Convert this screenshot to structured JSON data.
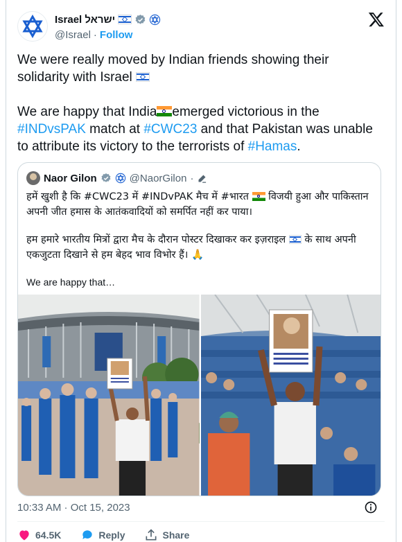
{
  "tweet": {
    "display_name": "Israel ישראל",
    "handle": "@Israel",
    "separator": "·",
    "follow_label": "Follow",
    "paragraph1": "We were really moved by Indian friends showing their solidarity with Israel",
    "p2_part1": "We are happy that India",
    "p2_part2": "emerged victorious in the",
    "hashtag1": "#INDvsPAK",
    "p2_part3": " match at ",
    "hashtag2": "#CWC23",
    "p2_part4": " and that Pakistan was unable to attribute its victory to the terrorists of ",
    "hashtag3": "#Hamas",
    "p2_part5": ".",
    "timestamp": "10:33 AM · Oct 15, 2023"
  },
  "quote": {
    "name": "Naor Gilon",
    "handle": "@NaorGilon",
    "separator": "·",
    "hindi1_a": "हमें खुशी है कि #CWC23 में #INDvPAK मैच में #भारत",
    "hindi1_b": "विजयी हुआ और पाकिस्तान अपनी जीत हमास के आतंकवादियों को समर्पित नहीं कर पाया।",
    "hindi2_a": "हम हमारे भारतीय मित्रों द्वारा मैच के दौरान पोस्टर दिखाकर कर इज़राइल",
    "hindi2_b": "के साथ अपनी एकजुटता दिखाने से हम बेहद भाव विभोर हैं।",
    "hindi2_emoji": "🙏",
    "more_text": "We are happy that…"
  },
  "actions": {
    "likes": "64.5K",
    "reply_label": "Reply",
    "share_label": "Share"
  },
  "colors": {
    "link_blue": "#1d9bf0",
    "like_red": "#f91880",
    "muted": "#536471",
    "text": "#0f1419"
  },
  "icons": [
    "israel-star-of-david-avatar",
    "israel-flag-icon",
    "verified-badge-icon",
    "gov-affiliation-icon",
    "x-logo-icon",
    "india-flag-icon",
    "edit-pencil-icon",
    "info-icon",
    "heart-icon",
    "reply-icon",
    "share-icon"
  ]
}
